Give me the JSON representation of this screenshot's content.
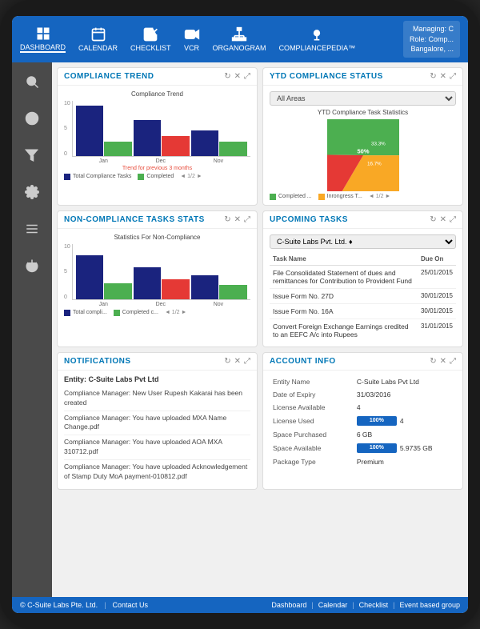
{
  "header": {
    "nav_items": [
      {
        "id": "dashboard",
        "label": "DASHBOARD",
        "active": true
      },
      {
        "id": "calendar",
        "label": "CALENDAR"
      },
      {
        "id": "checklist",
        "label": "CHECKLIST"
      },
      {
        "id": "vcr",
        "label": "VCR"
      },
      {
        "id": "organogram",
        "label": "ORGANOGRAM"
      },
      {
        "id": "compliancepedia",
        "label": "COMPLIANCEPEDIA™"
      }
    ],
    "user_info": {
      "managing": "Managing: C",
      "role": "Role: Comp...",
      "location": "Bangalore, ..."
    }
  },
  "sidebar": {
    "icons": [
      "search",
      "info",
      "filter",
      "settings",
      "menu",
      "power"
    ]
  },
  "compliance_trend": {
    "title": "COMPLIANCE TREND",
    "chart_title": "Compliance Trend",
    "x_labels": [
      "Jan",
      "Dec",
      "Nov"
    ],
    "trend_note": "Trend for previous 3 months",
    "legend_total": "Total Compliance Tasks",
    "legend_completed": "Completed",
    "pagination": "◄ 1/2 ►"
  },
  "ytd_status": {
    "title": "YTD COMPLIANCE STATUS",
    "select_label": "All Areas",
    "chart_title": "YTD Compliance Task Statistics",
    "segments": [
      {
        "label": "Completed ...",
        "value": 50,
        "color": "#4caf50",
        "percent_label": "50%"
      },
      {
        "label": "Inrongress T...",
        "value": 33.3,
        "color": "#f9a825",
        "percent_label": "33.3%"
      },
      {
        "label": "",
        "value": 16.7,
        "color": "#e53935",
        "percent_label": "16.7%"
      }
    ],
    "pagination": "◄ 1/2 ►"
  },
  "non_compliance": {
    "title": "NON-COMPLIANCE TASKS STATS",
    "chart_title": "Statistics For Non-Compliance",
    "x_labels": [
      "Jan",
      "Dec",
      "Nov"
    ],
    "legend_total": "Total compli...",
    "legend_completed": "Completed c...",
    "pagination": "◄ 1/2 ►"
  },
  "upcoming_tasks": {
    "title": "UPCOMING TASKS",
    "select_label": "C-Suite Labs Pvt. Ltd. ♦",
    "columns": [
      "Task Name",
      "Due On"
    ],
    "tasks": [
      {
        "name": "File Consolidated Statement of dues and remittances for Contribution to Provident Fund",
        "due": "25/01/2015"
      },
      {
        "name": "Issue Form No. 27D",
        "due": "30/01/2015"
      },
      {
        "name": "Issue Form No. 16A",
        "due": "30/01/2015"
      },
      {
        "name": "Convert Foreign Exchange Earnings credited to an EEFC A/c into Rupees",
        "due": "31/01/2015"
      }
    ]
  },
  "notifications": {
    "title": "NOTIFICATIONS",
    "entity": "Entity: C-Suite Labs Pvt Ltd",
    "items": [
      "Compliance Manager: New User Rupesh Kakarai has been created",
      "Compliance Manager: You have uploaded MXA Name Change.pdf",
      "Compliance Manager: You have uploaded AOA MXA 310712.pdf",
      "Compliance Manager: You have uploaded Acknowledgement of Stamp Duty MoA payment-010812.pdf"
    ]
  },
  "account_info": {
    "title": "ACCOUNT INFO",
    "rows": [
      {
        "label": "Entity Name",
        "value": "C-Suite Labs Pvt Ltd"
      },
      {
        "label": "Date of Expiry",
        "value": "31/03/2016"
      },
      {
        "label": "License Available",
        "value": "4"
      },
      {
        "label": "License Used",
        "value": "4",
        "has_bar": true,
        "bar_pct": 100
      },
      {
        "label": "Space Purchased",
        "value": "6 GB"
      },
      {
        "label": "Space Available",
        "value": "5.9735 GB",
        "has_bar": true,
        "bar_pct": 100
      },
      {
        "label": "Package Type",
        "value": "Premium"
      }
    ]
  },
  "footer": {
    "copyright": "© C-Suite Labs Pte. Ltd.",
    "contact": "Contact Us",
    "links": [
      "Dashboard",
      "Calendar",
      "Checklist",
      "Event based group"
    ]
  }
}
